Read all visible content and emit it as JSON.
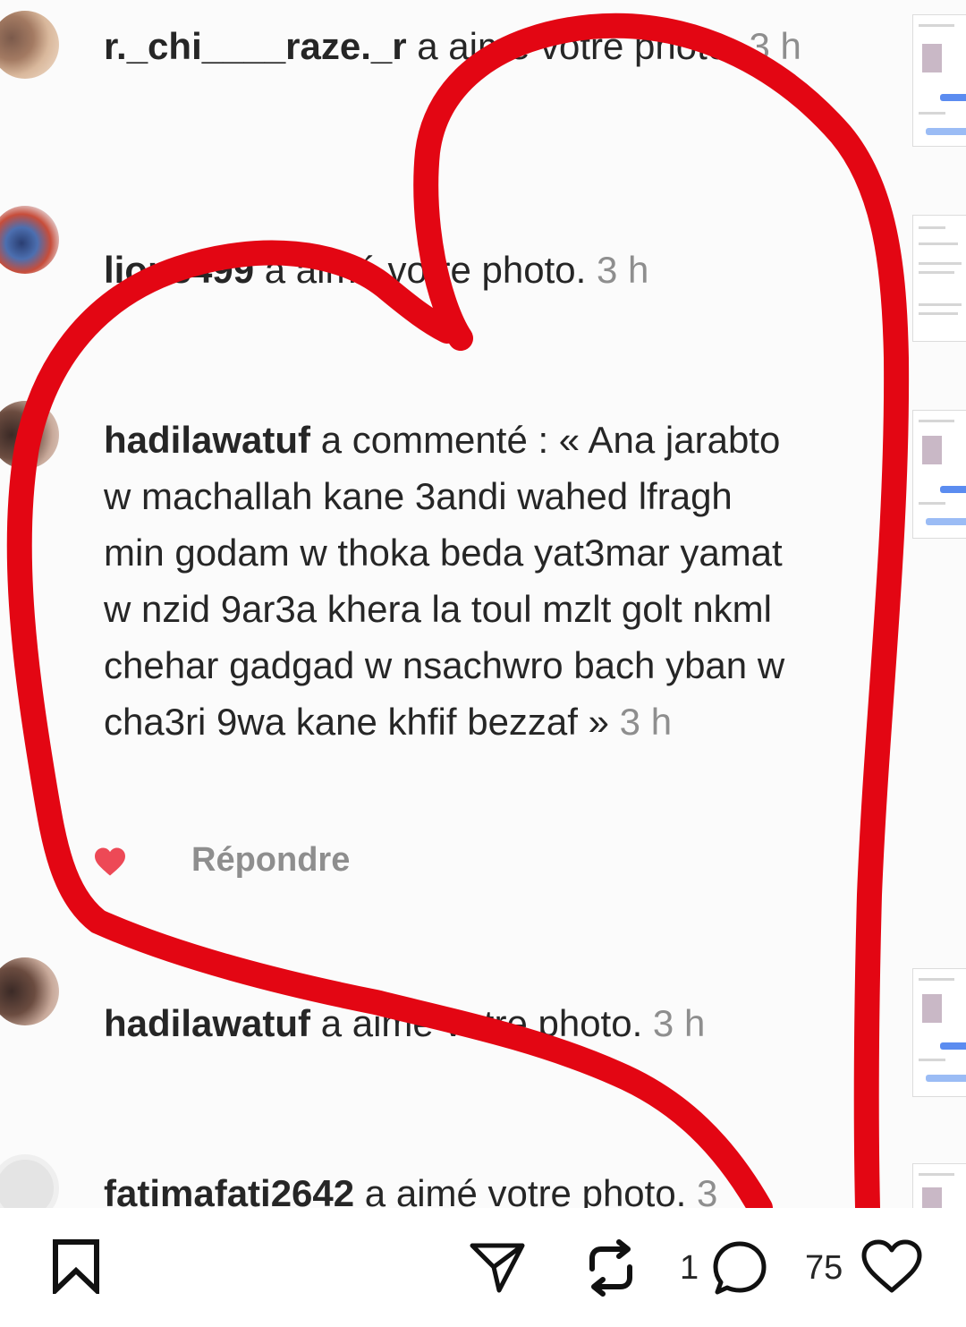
{
  "notifications": [
    {
      "user": "r._chi____raze._r",
      "action": " a aimé votre photo. ",
      "time": "3 h"
    },
    {
      "user": "lion3499",
      "action": " a aimé votre photo. ",
      "time": "3 h"
    },
    {
      "user": "hadilawatuf",
      "action": " a commenté : « Ana jarabto w machallah kane 3andi wahed lfragh min godam w thoka beda yat3mar yamat w nzid 9ar3a khera la toul mzlt golt nkml chehar gadgad w nsachwro bach yban w cha3ri 9wa kane khfif bezzaf » ",
      "time": "3 h",
      "reply_label": "Répondre"
    },
    {
      "user": "hadilawatuf",
      "action": " a aimé votre photo. ",
      "time": "3 h"
    },
    {
      "user": "fatimafati2642",
      "action": " a aimé votre photo. ",
      "time": "3"
    }
  ],
  "bottom_bar": {
    "bookmark_icon": "bookmark-icon",
    "share_icon": "send-icon",
    "repost_icon": "repost-icon",
    "comment_count": "1",
    "comment_icon": "comment-icon",
    "like_count": "75",
    "like_icon": "heart-outline-icon"
  },
  "colors": {
    "drawn_heart": "#e30613",
    "liked_heart": "#ed4956",
    "timestamp": "#8e8e8e"
  }
}
